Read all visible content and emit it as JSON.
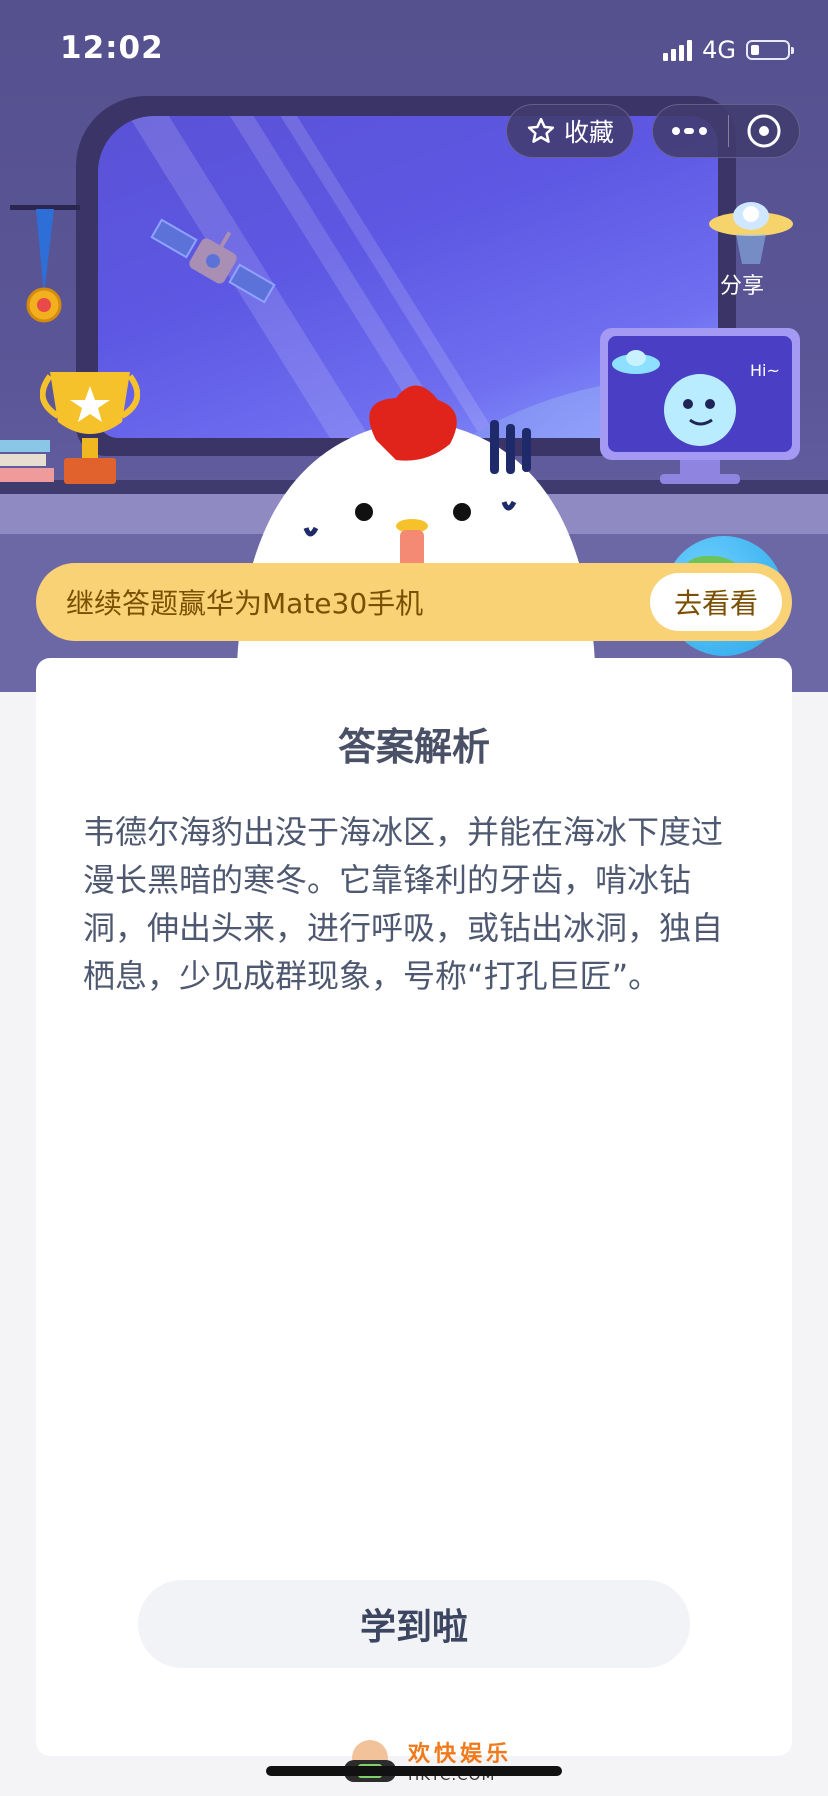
{
  "status_bar": {
    "time": "12:02",
    "network": "4G"
  },
  "top_bar": {
    "favorite_label": "收藏",
    "share_label": "分享"
  },
  "scene": {
    "monitor_text": "Hi~"
  },
  "promo": {
    "text": "继续答题赢华为Mate30手机",
    "button_label": "去看看"
  },
  "card": {
    "title": "答案解析",
    "body": "韦德尔海豹出没于海冰区，并能在海冰下度过漫长黑暗的寒冬。它靠锋利的牙齿，啃冰钻洞，伸出头来，进行呼吸，或钻出冰洞，独自栖息，少见成群现象，号称“打孔巨匠”。",
    "button_label": "学到啦"
  },
  "watermark": {
    "name": "欢快娱乐",
    "url": "HKYC.COM"
  },
  "colors": {
    "promo_bg": "#f9d276",
    "promo_text": "#7a4f00",
    "scene_bg": "#55508e",
    "card_text": "#4e5870"
  }
}
